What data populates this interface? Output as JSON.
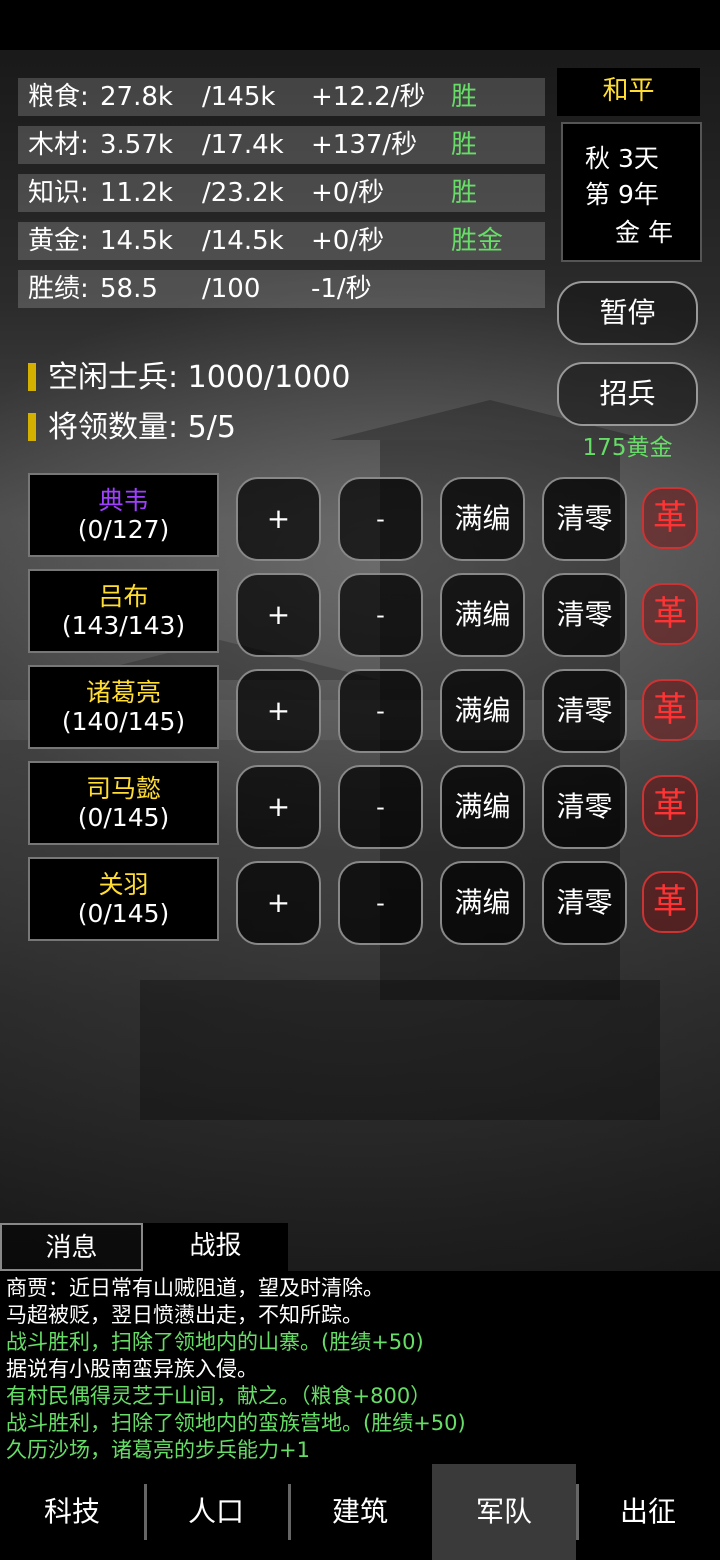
{
  "resources": [
    {
      "name": "粮食:",
      "current": "27.8k",
      "max": "/145k",
      "rate": "+12.2/秒",
      "tag": "胜"
    },
    {
      "name": "木材:",
      "current": "3.57k",
      "max": "/17.4k",
      "rate": "+137/秒",
      "tag": "胜"
    },
    {
      "name": "知识:",
      "current": "11.2k",
      "max": "/23.2k",
      "rate": "+0/秒",
      "tag": "胜"
    },
    {
      "name": "黄金:",
      "current": "14.5k",
      "max": "/14.5k",
      "rate": "+0/秒",
      "tag": "胜金"
    },
    {
      "name": "胜绩:",
      "current": "58.5",
      "max": "/100",
      "rate": "-1/秒",
      "tag": ""
    }
  ],
  "status": {
    "peace": "和平",
    "season_day": "秋 3天",
    "year": "第 9年",
    "element_year": "金 年"
  },
  "buttons": {
    "pause": "暂停",
    "recruit": "招兵",
    "recruit_cost": "175黄金"
  },
  "soldiers": {
    "idle_label": "空闲士兵:",
    "idle_value": "1000/1000",
    "generals_label": "将领数量:",
    "generals_value": "5/5"
  },
  "general_actions": {
    "plus": "+",
    "minus": "-",
    "full": "满编",
    "clear": "清零",
    "revolt": "革"
  },
  "generals": [
    {
      "name": "典韦",
      "count": "(0/127)",
      "color": "#a040ff"
    },
    {
      "name": "吕布",
      "count": "(143/143)",
      "color": "#ffdd33"
    },
    {
      "name": "诸葛亮",
      "count": "(140/145)",
      "color": "#ffdd33"
    },
    {
      "name": "司马懿",
      "count": "(0/145)",
      "color": "#ffdd33"
    },
    {
      "name": "关羽",
      "count": "(0/145)",
      "color": "#ffdd33"
    }
  ],
  "tabs": {
    "messages": "消息",
    "battle": "战报"
  },
  "log": [
    {
      "text": "商贾：近日常有山贼阻道，望及时清除。",
      "color": "#ffffff"
    },
    {
      "text": "马超被贬，翌日愤懑出走，不知所踪。",
      "color": "#ffffff"
    },
    {
      "text": "战斗胜利，扫除了领地内的山寨。(胜绩+50)",
      "color": "#66dd66"
    },
    {
      "text": "据说有小股南蛮异族入侵。",
      "color": "#ffffff"
    },
    {
      "text": "有村民偶得灵芝于山间，献之。（粮食+800）",
      "color": "#66dd66"
    },
    {
      "text": "战斗胜利，扫除了领地内的蛮族营地。(胜绩+50)",
      "color": "#66dd66"
    },
    {
      "text": "久历沙场，诸葛亮的步兵能力+1",
      "color": "#66dd66"
    }
  ],
  "nav": [
    "科技",
    "人口",
    "建筑",
    "军队",
    "出征"
  ],
  "nav_active": "军队"
}
